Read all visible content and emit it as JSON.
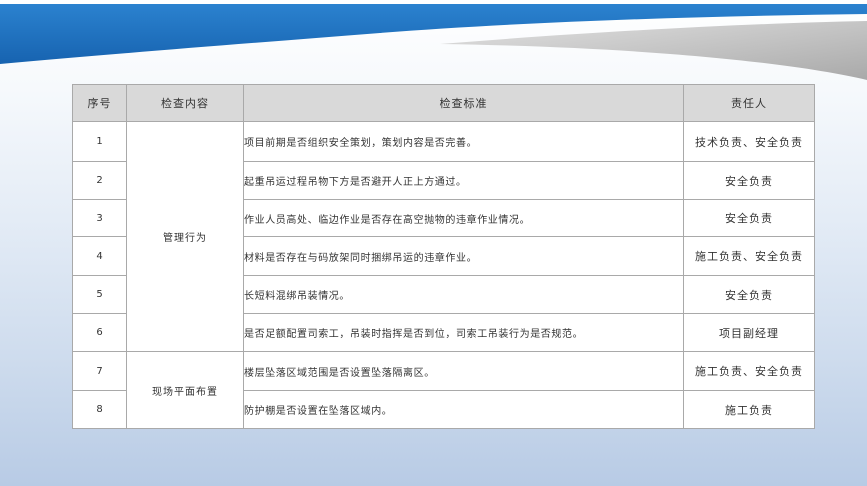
{
  "theme": {
    "accent_blue": "#1d6fbd",
    "swoosh_gray": "#c4c4c4",
    "header_bg": "#d9d9d9"
  },
  "table": {
    "headers": {
      "no": "序号",
      "content": "检查内容",
      "standard": "检查标准",
      "owner": "责任人"
    },
    "groups": [
      {
        "content": "管理行为"
      },
      {
        "content": "现场平面布置"
      }
    ],
    "rows": [
      {
        "no": "1",
        "standard": "项目前期是否组织安全策划，策划内容是否完善。",
        "owner": "技术负责、安全负责"
      },
      {
        "no": "2",
        "standard": "起重吊运过程吊物下方是否避开人正上方通过。",
        "owner": "安全负责"
      },
      {
        "no": "3",
        "standard": "作业人员高处、临边作业是否存在高空抛物的违章作业情况。",
        "owner": "安全负责"
      },
      {
        "no": "4",
        "standard": "材料是否存在与码放架同时捆绑吊运的违章作业。",
        "owner": "施工负责、安全负责"
      },
      {
        "no": "5",
        "standard": "长短料混绑吊装情况。",
        "owner": "安全负责"
      },
      {
        "no": "6",
        "standard": "是否足额配置司索工，吊装时指挥是否到位，司索工吊装行为是否规范。",
        "owner": "项目副经理"
      },
      {
        "no": "7",
        "standard": "楼层坠落区域范围是否设置坠落隔离区。",
        "owner": "施工负责、安全负责"
      },
      {
        "no": "8",
        "standard": "防护棚是否设置在坠落区域内。",
        "owner": "施工负责"
      }
    ]
  }
}
